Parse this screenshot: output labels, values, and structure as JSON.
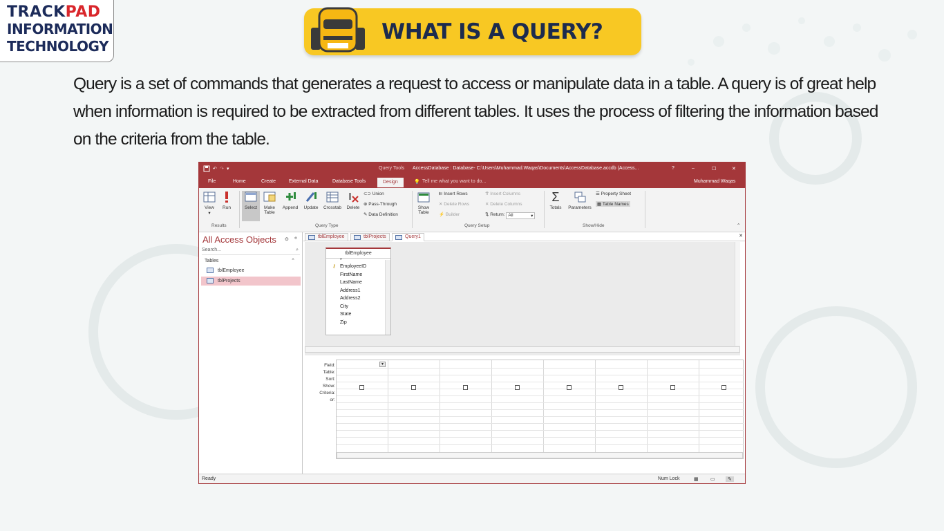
{
  "logo": {
    "line1_a": "TRACK",
    "line1_b": "PAD",
    "line2": "INFORMATION",
    "line3": "TECHNOLOGY"
  },
  "banner": {
    "title": "WHAT IS A QUERY?"
  },
  "intro_text": "Query is a set of commands that generates a request to access or manipulate data in a table. A query is of great help when information is required to be extracted from different tables. It uses the process of filtering the information based on the criteria from the table.",
  "access": {
    "context_label": "Query Tools",
    "window_title": "AccessDatabase : Database- C:\\Users\\Muhammad.Waqas\\Documents\\AccessDatabase.accdb (Access...",
    "help_glyph": "?",
    "min_glyph": "–",
    "max_glyph": "☐",
    "close_glyph": "✕",
    "user": "Muhammad Waqas",
    "tabs": [
      "File",
      "Home",
      "Create",
      "External Data",
      "Database Tools",
      "Design"
    ],
    "tell_me": "Tell me what you want to do...",
    "ribbon": {
      "results": {
        "label": "Results",
        "view": "View",
        "run": "Run"
      },
      "query_type": {
        "label": "Query Type",
        "select": "Select",
        "make_table_1": "Make",
        "make_table_2": "Table",
        "append": "Append",
        "update": "Update",
        "crosstab": "Crosstab",
        "delete": "Delete",
        "union": "Union",
        "pass_through": "Pass-Through",
        "data_definition": "Data Definition"
      },
      "query_setup": {
        "label": "Query Setup",
        "show_table_1": "Show",
        "show_table_2": "Table",
        "insert_rows": "Insert Rows",
        "delete_rows": "Delete Rows",
        "builder": "Builder",
        "insert_columns": "Insert Columns",
        "delete_columns": "Delete Columns",
        "return_label": "Return:",
        "return_value": "All"
      },
      "show_hide": {
        "label": "Show/Hide",
        "totals": "Totals",
        "parameters": "Parameters",
        "property_sheet": "Property Sheet",
        "table_names": "Table Names"
      }
    },
    "nav": {
      "header": "All Access Objects",
      "search_placeholder": "Search...",
      "section": "Tables",
      "items": [
        "tblEmployee",
        "tblProjects"
      ]
    },
    "doc_tabs": [
      "tblEmployee",
      "tblProjects",
      "Query1"
    ],
    "table_box": {
      "title": "tblEmployee",
      "star": "*",
      "fields": [
        "EmployeeID",
        "FirstName",
        "LastName",
        "Address1",
        "Address2",
        "City",
        "State",
        "Zip"
      ]
    },
    "grid_rows": [
      "Field:",
      "Table:",
      "Sort:",
      "Show:",
      "Criteria:",
      "or:"
    ],
    "status": {
      "left": "Ready",
      "num_lock": "Num Lock"
    }
  }
}
